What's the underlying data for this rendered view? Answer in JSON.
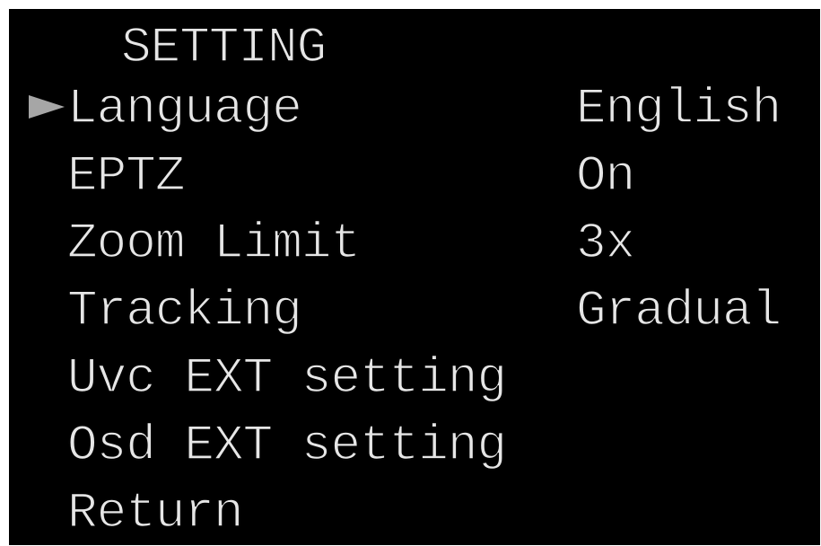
{
  "menu": {
    "title": "SETTING",
    "items": [
      {
        "label": "Language",
        "value": "English",
        "selected": true
      },
      {
        "label": "EPTZ",
        "value": "On",
        "selected": false
      },
      {
        "label": "Zoom Limit",
        "value": "3x",
        "selected": false
      },
      {
        "label": "Tracking",
        "value": "Gradual",
        "selected": false
      },
      {
        "label": "Uvc EXT setting",
        "value": "",
        "selected": false
      },
      {
        "label": "Osd EXT setting",
        "value": "",
        "selected": false
      },
      {
        "label": "Return",
        "value": "",
        "selected": false
      }
    ]
  },
  "colors": {
    "background": "#000000",
    "text": "#e6e6e6",
    "cursor": "#a6a6a6"
  },
  "icons": {
    "cursor": "triangle-right-icon"
  }
}
